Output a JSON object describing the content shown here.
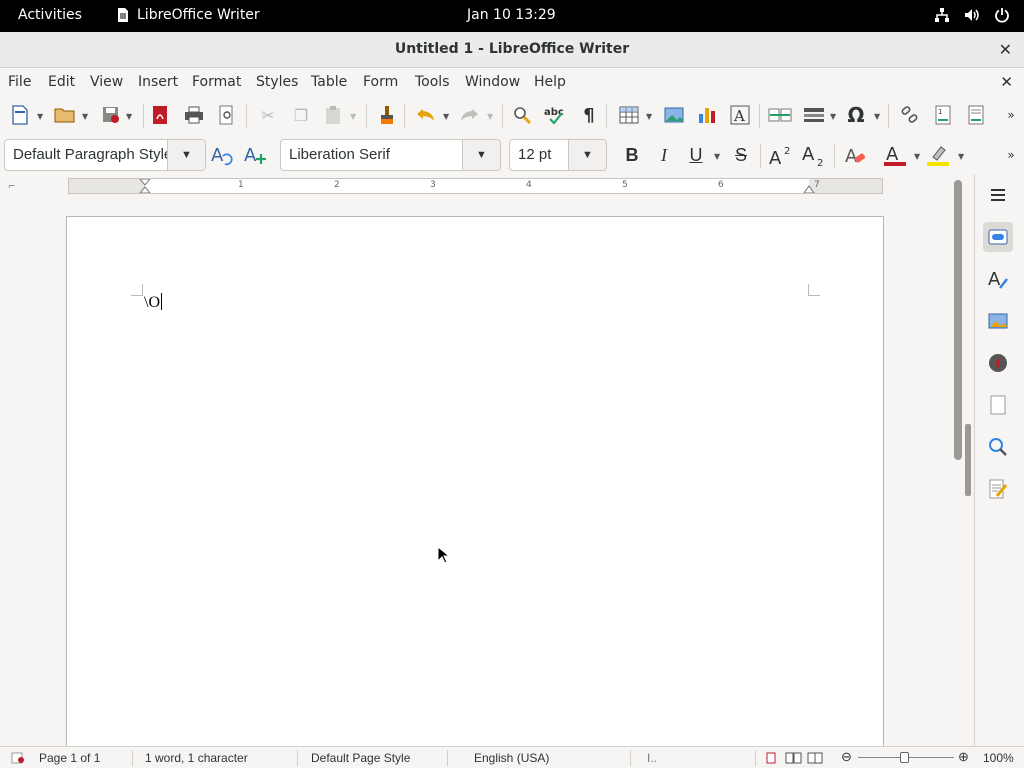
{
  "topbar": {
    "activities": "Activities",
    "app_name": "LibreOffice Writer",
    "clock": "Jan 10  13:29"
  },
  "window": {
    "title": "Untitled 1 - LibreOffice Writer",
    "close_glyph": "✕"
  },
  "menubar": [
    "File",
    "Edit",
    "View",
    "Insert",
    "Format",
    "Styles",
    "Table",
    "Form",
    "Tools",
    "Window",
    "Help"
  ],
  "formatting": {
    "paragraph_style": "Default Paragraph Style",
    "font_name": "Liberation Serif",
    "font_size": "12 pt",
    "bold": "B",
    "italic": "I",
    "underline": "U",
    "strike": "S"
  },
  "ruler": {
    "numbers": [
      "1",
      "2",
      "3",
      "4",
      "5",
      "6",
      "7"
    ]
  },
  "document": {
    "text": "\\O"
  },
  "statusbar": {
    "page": "Page 1 of 1",
    "word_count": "1 word, 1 character",
    "page_style": "Default Page Style",
    "language": "English (USA)",
    "zoom": "100%"
  },
  "colors": {
    "accent_red": "#c01c28",
    "highlight_yellow": "#f5e400",
    "font_color_red": "#c01c28"
  }
}
